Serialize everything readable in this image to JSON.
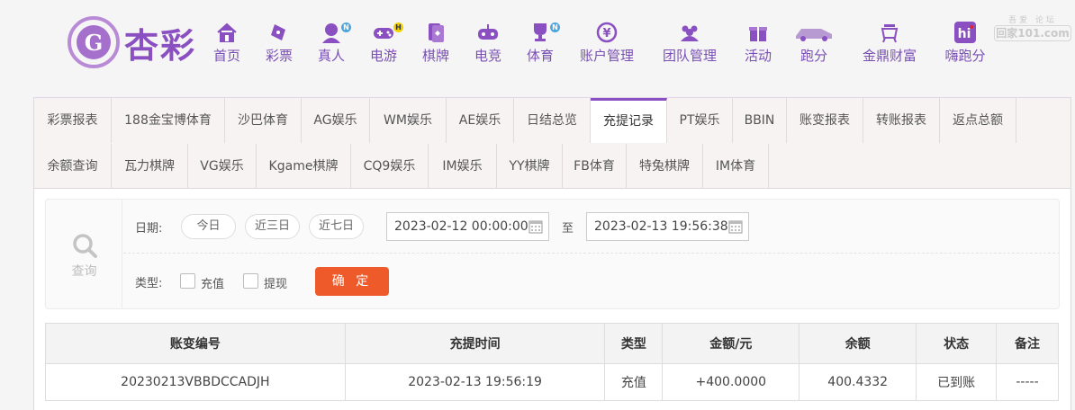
{
  "brand": {
    "logo_text": "杏彩",
    "accent": "#8a4fc0"
  },
  "watermark": {
    "top": "吾爱 论坛",
    "main": "回家101.com"
  },
  "nav": [
    {
      "label": "首页",
      "icon": "home-icon"
    },
    {
      "label": "彩票",
      "icon": "lottery-ticket-icon"
    },
    {
      "label": "真人",
      "icon": "live-dealer-icon",
      "badge": "N"
    },
    {
      "label": "电游",
      "icon": "gamepad-icon",
      "badge": "H"
    },
    {
      "label": "棋牌",
      "icon": "cards-icon"
    },
    {
      "label": "电竞",
      "icon": "controller-icon"
    },
    {
      "label": "体育",
      "icon": "trophy-icon",
      "badge": "N"
    },
    {
      "label": "账户管理",
      "icon": "yen-coin-icon"
    },
    {
      "label": "团队管理",
      "icon": "team-icon"
    },
    {
      "label": "活动",
      "icon": "gift-icon"
    },
    {
      "label": "跑分",
      "icon": "car-icon"
    },
    {
      "label": "金鼎财富",
      "icon": "cauldron-icon"
    },
    {
      "label": "嗨跑分",
      "icon": "hi-app-icon"
    }
  ],
  "tabs_row1": [
    "彩票报表",
    "188金宝博体育",
    "沙巴体育",
    "AG娱乐",
    "WM娱乐",
    "AE娱乐",
    "日结总览",
    "充提记录",
    "PT娱乐",
    "BBIN",
    "账变报表",
    "转账报表",
    "返点总额"
  ],
  "tabs_row2": [
    "余额查询",
    "瓦力棋牌",
    "VG娱乐",
    "Kgame棋牌",
    "CQ9娱乐",
    "IM娱乐",
    "YY棋牌",
    "FB体育",
    "特兔棋牌",
    "IM体育"
  ],
  "active_tab": "充提记录",
  "query": {
    "side_label": "查询",
    "date_label": "日期:",
    "quick_dates": [
      "今日",
      "近三日",
      "近七日"
    ],
    "start": "2023-02-12 00:00:00",
    "to": "至",
    "end": "2023-02-13 19:56:38",
    "type_label": "类型:",
    "types": [
      "充值",
      "提现"
    ],
    "submit": "确 定"
  },
  "table": {
    "headers": [
      "账变编号",
      "充提时间",
      "类型",
      "金额/元",
      "余额",
      "状态",
      "备注"
    ],
    "rows": [
      [
        "20230213VBBDCCADJH",
        "2023-02-13 19:56:19",
        "充值",
        "+400.0000",
        "400.4332",
        "已到账",
        "-----"
      ]
    ]
  }
}
